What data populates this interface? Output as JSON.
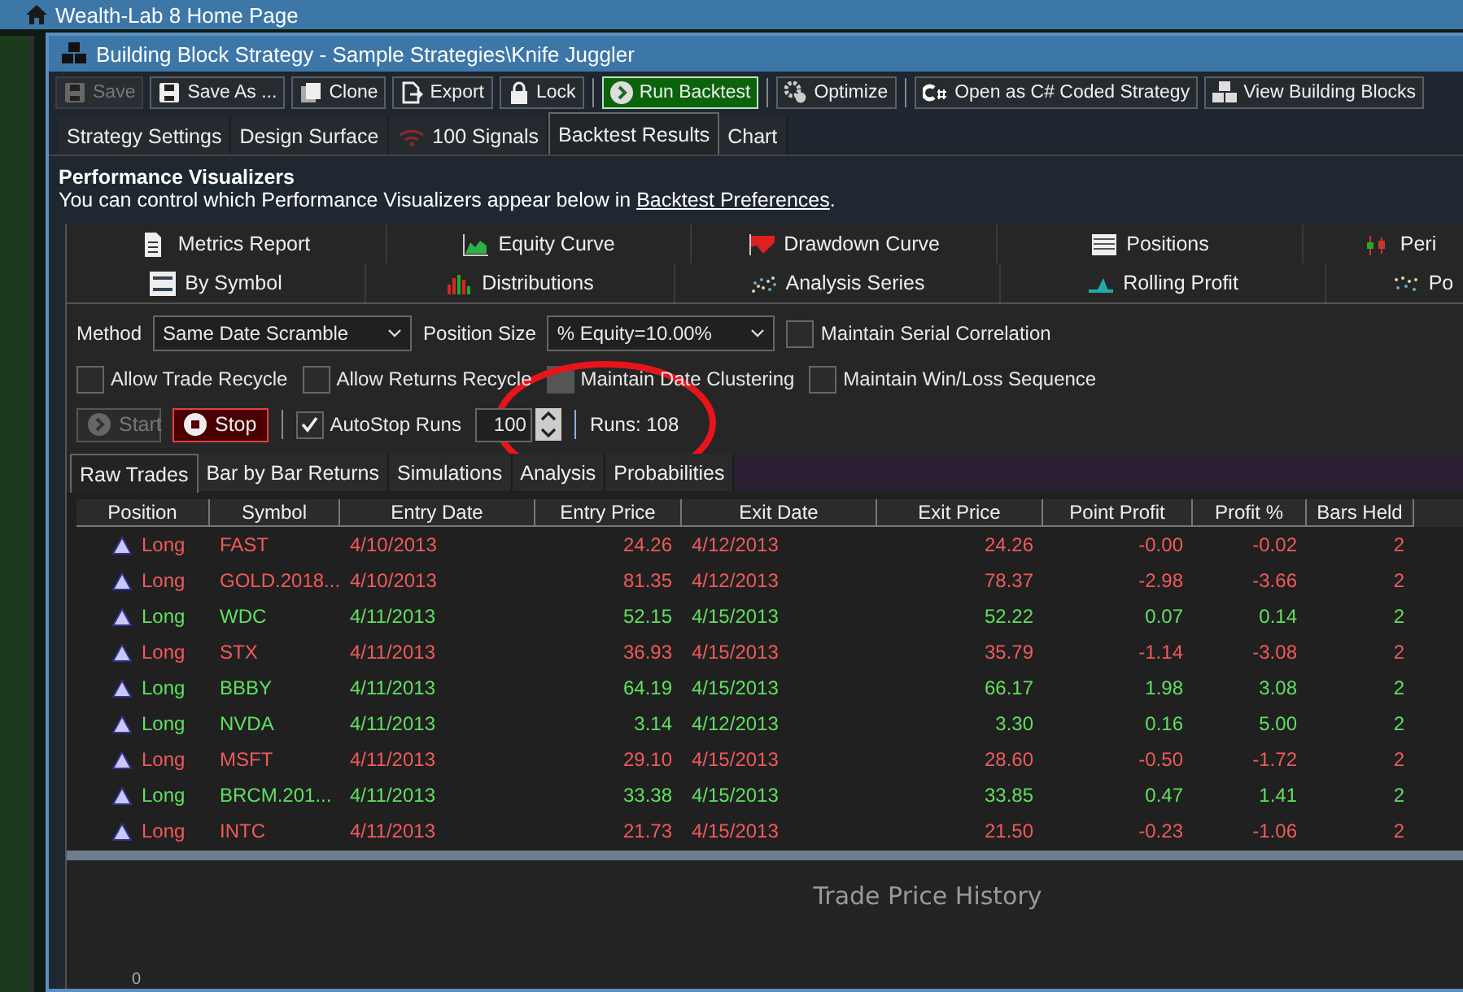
{
  "app_title": "Wealth-Lab 8 Home Page",
  "window": {
    "title": "Building Block Strategy - Sample Strategies\\Knife Juggler"
  },
  "toolbar": [
    {
      "kind": "button",
      "label": "Save",
      "disabled": true
    },
    {
      "kind": "button",
      "label": "Save As ...",
      "disabled": false
    },
    {
      "kind": "button",
      "label": "Clone",
      "disabled": false
    },
    {
      "kind": "button",
      "label": "Export",
      "disabled": false
    },
    {
      "kind": "button",
      "label": "Lock",
      "disabled": false
    },
    {
      "kind": "separator"
    },
    {
      "kind": "primary",
      "label": "Run Backtest",
      "disabled": false
    },
    {
      "kind": "separator"
    },
    {
      "kind": "button",
      "label": "Optimize",
      "disabled": false
    },
    {
      "kind": "separator"
    },
    {
      "kind": "button",
      "label": "Open as C# Coded Strategy",
      "disabled": false
    },
    {
      "kind": "button",
      "label": "View Building Blocks",
      "disabled": false
    }
  ],
  "tabs": [
    {
      "label": "Strategy Settings",
      "selected": false
    },
    {
      "label": "Design Surface",
      "selected": false
    },
    {
      "label": "100 Signals",
      "selected": false
    },
    {
      "label": "Backtest Results",
      "selected": true
    },
    {
      "label": "Chart",
      "selected": false
    }
  ],
  "performance": {
    "heading": "Performance Visualizers",
    "text": "You can control which Performance Visualizers appear below in ",
    "link": "Backtest Preferences",
    "suffix": "."
  },
  "visualizers": [
    [
      {
        "label": "Metrics Report"
      },
      {
        "label": "Equity Curve"
      },
      {
        "label": "Drawdown Curve"
      },
      {
        "label": "Positions"
      },
      {
        "label": "Peri"
      }
    ],
    [
      {
        "label": "By Symbol"
      },
      {
        "label": "Distributions"
      },
      {
        "label": "Analysis Series"
      },
      {
        "label": "Rolling Profit"
      },
      {
        "label": "Po"
      }
    ]
  ],
  "method": {
    "label": "Method",
    "value": "Same Date Scramble"
  },
  "position_size": {
    "label": "Position Size",
    "value": "% Equity=10.00%"
  },
  "options": [
    {
      "label": "Maintain Serial Correlation",
      "checked": false,
      "disabled": false
    },
    {
      "label": "Allow Trade Recycle",
      "checked": false,
      "disabled": false
    },
    {
      "label": "Allow Returns Recycle",
      "checked": false,
      "disabled": false
    },
    {
      "label": "Maintain Date Clustering",
      "checked": false,
      "disabled": true
    },
    {
      "label": "Maintain Win/Loss Sequence",
      "checked": false,
      "disabled": false
    }
  ],
  "run_controls": {
    "start": {
      "label": "Start",
      "disabled": true
    },
    "stop": {
      "label": "Stop",
      "disabled": false
    },
    "autostop": {
      "label": "AutoStop Runs",
      "checked": true
    },
    "runs_value": "100",
    "runs": "Runs: 108"
  },
  "sub_tabs": [
    {
      "label": "Raw Trades",
      "selected": true
    },
    {
      "label": "Bar by Bar Returns",
      "selected": false
    },
    {
      "label": "Simulations",
      "selected": false
    },
    {
      "label": "Analysis",
      "selected": false
    },
    {
      "label": "Probabilities",
      "selected": false
    }
  ],
  "table": {
    "columns": [
      "Position",
      "Symbol",
      "Entry Date",
      "Entry Price",
      "Exit Date",
      "Exit Price",
      "Point Profit",
      "Profit %",
      "Bars Held"
    ],
    "rows": [
      {
        "kind": "loss",
        "cells": [
          "Long",
          "FAST",
          "4/10/2013",
          "24.26",
          "4/12/2013",
          "24.26",
          "-0.00",
          "-0.02",
          "2"
        ]
      },
      {
        "kind": "loss",
        "cells": [
          "Long",
          "GOLD.2018...",
          "4/10/2013",
          "81.35",
          "4/12/2013",
          "78.37",
          "-2.98",
          "-3.66",
          "2"
        ]
      },
      {
        "kind": "gain",
        "cells": [
          "Long",
          "WDC",
          "4/11/2013",
          "52.15",
          "4/15/2013",
          "52.22",
          "0.07",
          "0.14",
          "2"
        ]
      },
      {
        "kind": "loss",
        "cells": [
          "Long",
          "STX",
          "4/11/2013",
          "36.93",
          "4/15/2013",
          "35.79",
          "-1.14",
          "-3.08",
          "2"
        ]
      },
      {
        "kind": "gain",
        "cells": [
          "Long",
          "BBBY",
          "4/11/2013",
          "64.19",
          "4/15/2013",
          "66.17",
          "1.98",
          "3.08",
          "2"
        ]
      },
      {
        "kind": "gain",
        "cells": [
          "Long",
          "NVDA",
          "4/11/2013",
          "3.14",
          "4/12/2013",
          "3.30",
          "0.16",
          "5.00",
          "2"
        ]
      },
      {
        "kind": "loss",
        "cells": [
          "Long",
          "MSFT",
          "4/11/2013",
          "29.10",
          "4/15/2013",
          "28.60",
          "-0.50",
          "-1.72",
          "2"
        ]
      },
      {
        "kind": "gain",
        "cells": [
          "Long",
          "BRCM.201...",
          "4/11/2013",
          "33.38",
          "4/15/2013",
          "33.85",
          "0.47",
          "1.41",
          "2"
        ]
      },
      {
        "kind": "loss",
        "cells": [
          "Long",
          "INTC",
          "4/11/2013",
          "21.73",
          "4/15/2013",
          "21.50",
          "-0.23",
          "-1.06",
          "2"
        ]
      }
    ]
  },
  "chart": {
    "title": "Trade Price History",
    "y_tick": "0"
  }
}
